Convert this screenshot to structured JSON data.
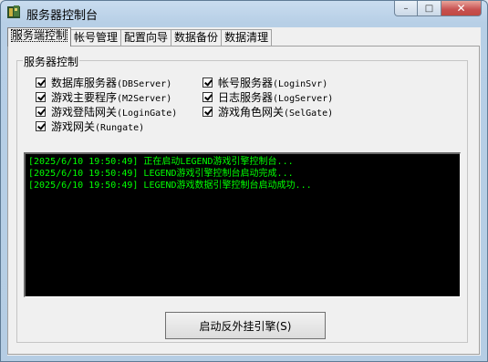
{
  "window": {
    "title": "服务器控制台",
    "close_glyph": "✕",
    "max_glyph": "□",
    "min_glyph": "–"
  },
  "tabs": [
    {
      "label": "服务端控制",
      "active": true
    },
    {
      "label": "帐号管理",
      "active": false
    },
    {
      "label": "配置向导",
      "active": false
    },
    {
      "label": "数据备份",
      "active": false
    },
    {
      "label": "数据清理",
      "active": false
    }
  ],
  "group": {
    "label": "服务器控制",
    "checkboxes": [
      {
        "cn": "数据库服务器",
        "en": "(DBServer)",
        "checked": true
      },
      {
        "cn": "游戏主要程序",
        "en": "(M2Server)",
        "checked": true
      },
      {
        "cn": "游戏登陆网关",
        "en": "(LoginGate)",
        "checked": true
      },
      {
        "cn": "游戏网关",
        "en": "(Rungate)",
        "checked": true
      },
      {
        "cn": "帐号服务器",
        "en": "(LoginSvr)",
        "checked": true
      },
      {
        "cn": "日志服务器",
        "en": "(LogServer)",
        "checked": true
      },
      {
        "cn": "游戏角色网关",
        "en": "(SelGate)",
        "checked": true
      }
    ]
  },
  "console": {
    "lines": [
      "[2025/6/10 19:50:49] 正在启动LEGEND游戏引擎控制台...",
      "[2025/6/10 19:50:49] LEGEND游戏引擎控制台启动完成...",
      "[2025/6/10 19:50:49] LEGEND游戏数据引擎控制台启动成功..."
    ],
    "text_color": "#00ff00"
  },
  "start_button": {
    "label": "启动反外挂引擎(S)"
  }
}
